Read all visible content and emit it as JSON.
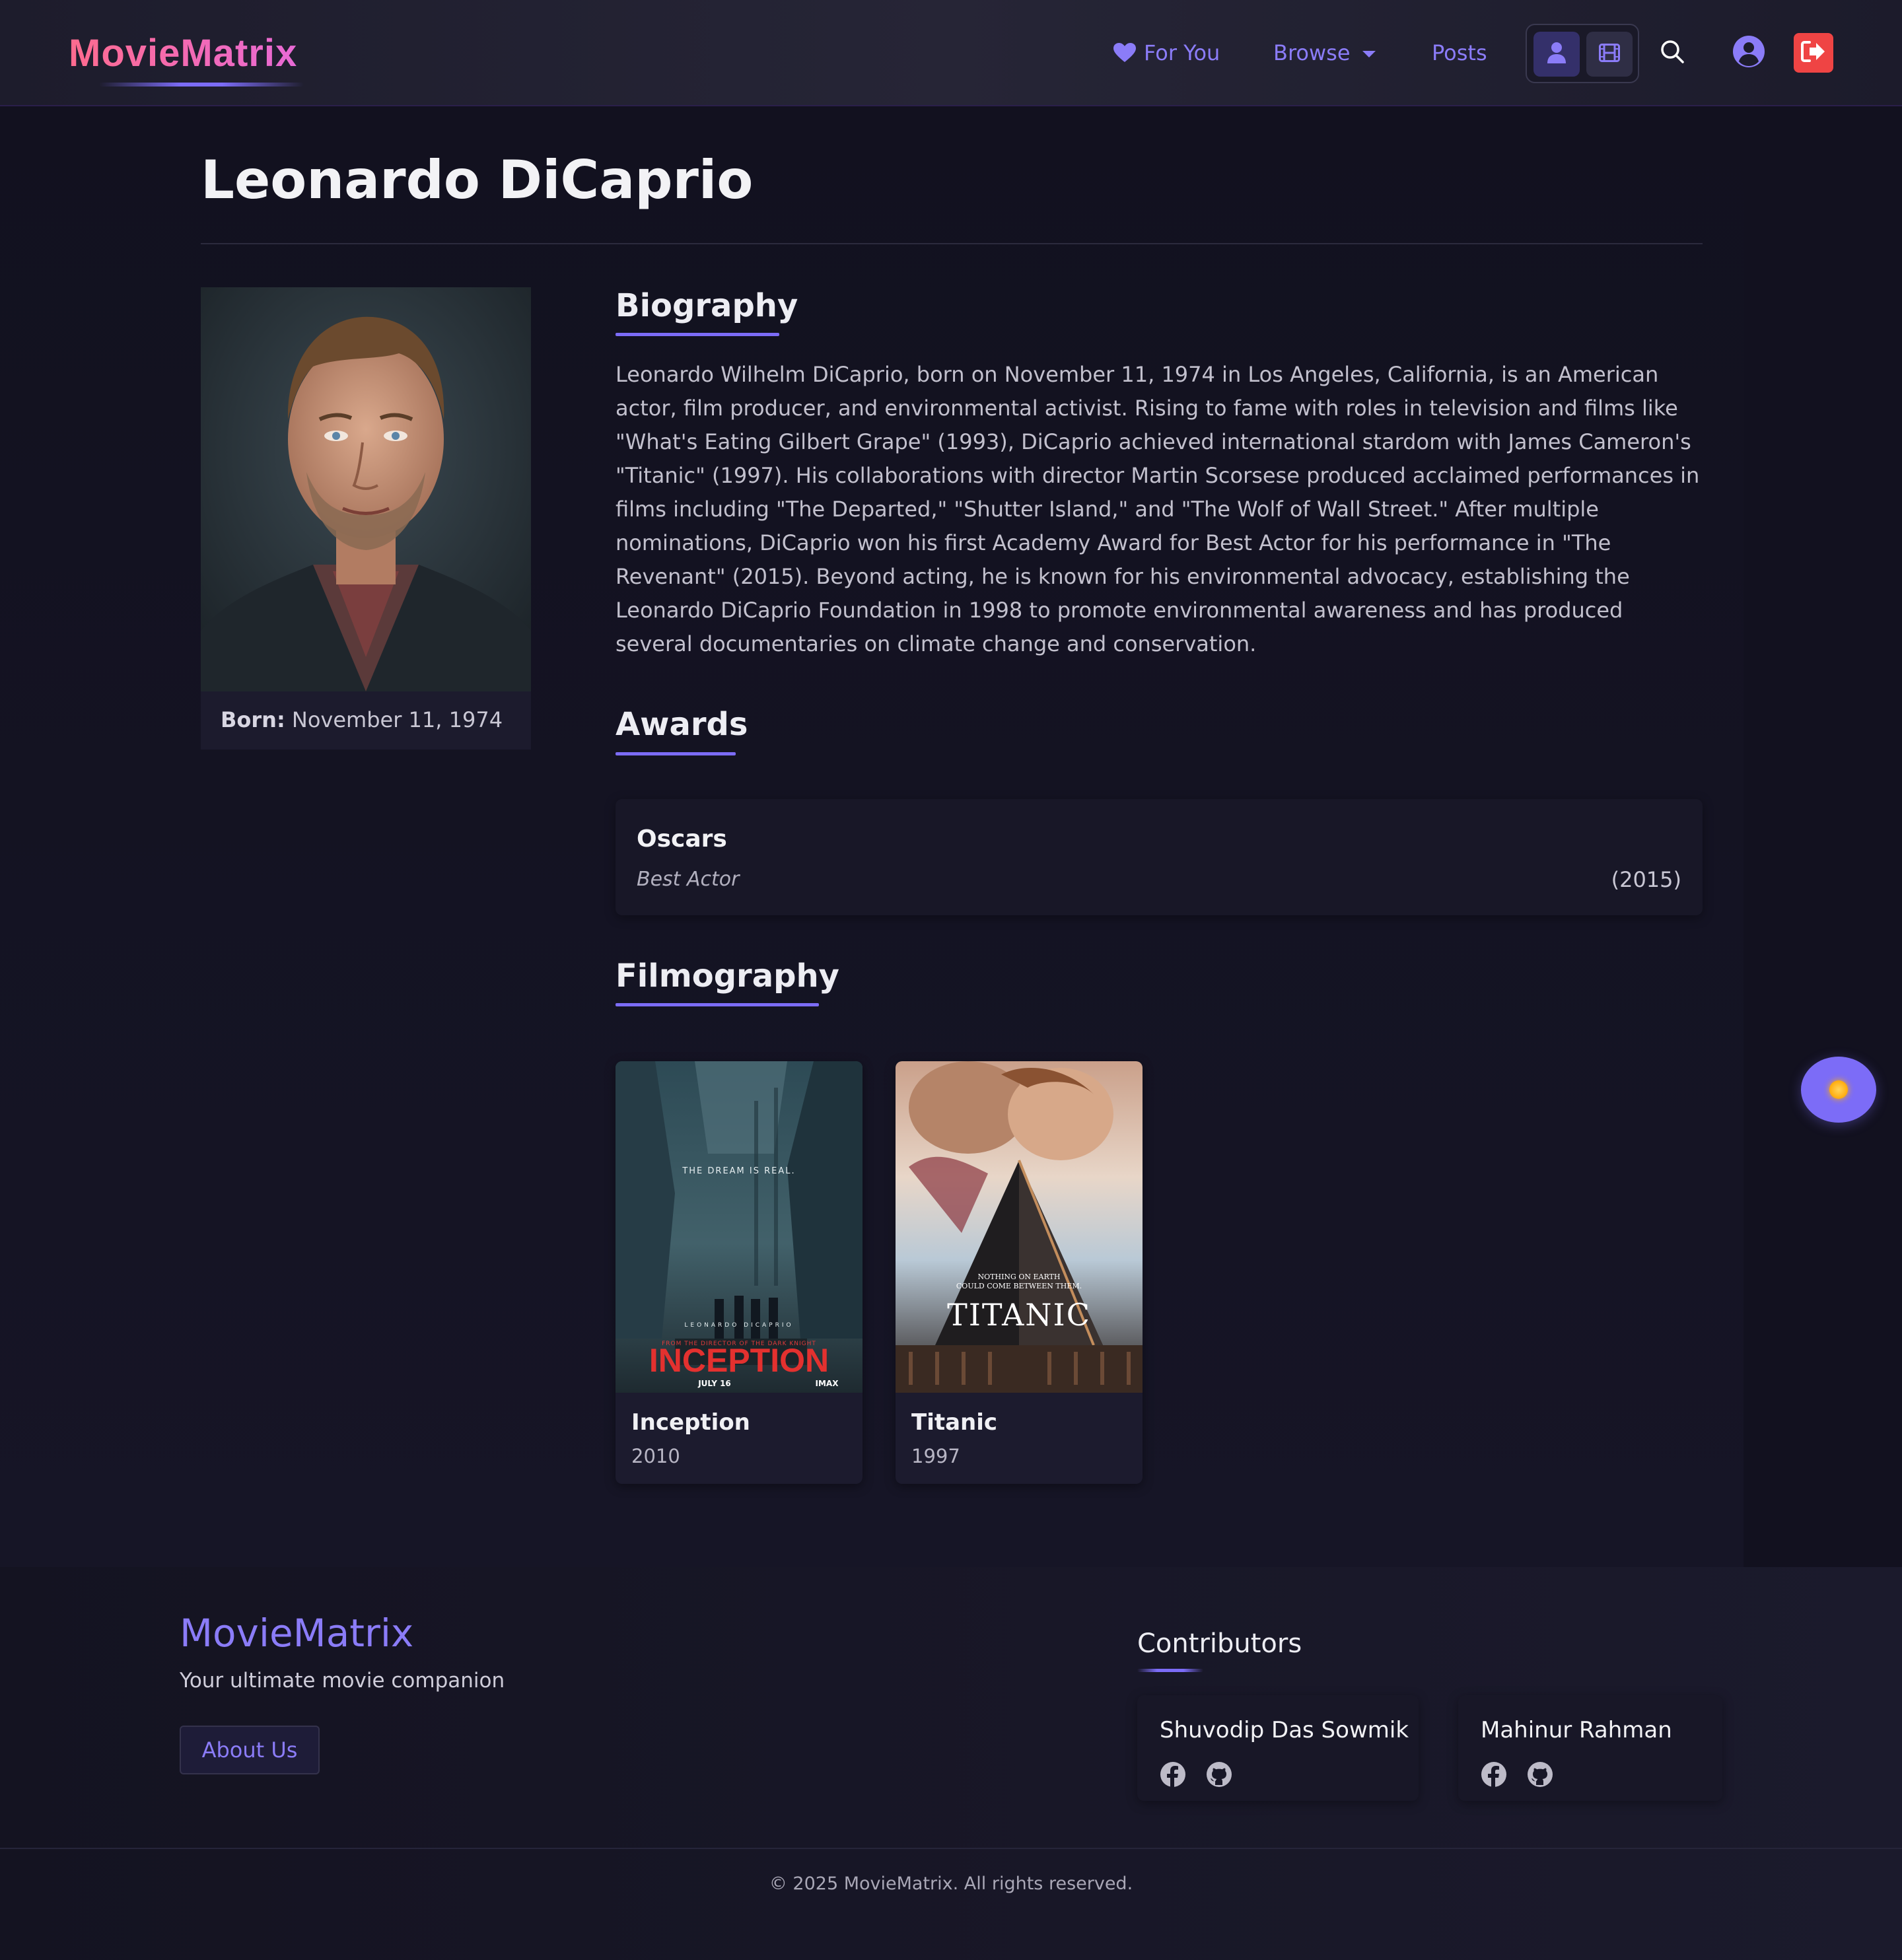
{
  "nav": {
    "brand": "MovieMatrix",
    "links": {
      "for_you": "For You",
      "browse": "Browse",
      "posts": "Posts"
    },
    "icons": [
      "heart-icon",
      "chevron-down-icon",
      "person-icon",
      "film-icon",
      "search-icon",
      "user-circle-icon",
      "logout-icon"
    ]
  },
  "person": {
    "name": "Leonardo DiCaprio",
    "born_label": "Born:",
    "born_value": "November 11, 1974"
  },
  "sections": {
    "biography": "Biography",
    "awards": "Awards",
    "filmography": "Filmography"
  },
  "biography_text": "Leonardo Wilhelm DiCaprio, born on November 11, 1974 in Los Angeles, California, is an American actor, film producer, and environmental activist. Rising to fame with roles in television and films like \"What's Eating Gilbert Grape\" (1993), DiCaprio achieved international stardom with James Cameron's \"Titanic\" (1997). His collaborations with director Martin Scorsese produced acclaimed performances in films including \"The Departed,\" \"Shutter Island,\" and \"The Wolf of Wall Street.\" After multiple nominations, DiCaprio won his first Academy Award for Best Actor for his performance in \"The Revenant\" (2015). Beyond acting, he is known for his environmental advocacy, establishing the Leonardo DiCaprio Foundation in 1998 to promote environmental awareness and has produced several documentaries on climate change and conservation.",
  "awards": [
    {
      "name": "Oscars",
      "category": "Best Actor",
      "year": "(2015)"
    }
  ],
  "films": [
    {
      "title": "Inception",
      "year": "2010",
      "poster": {
        "tagline": "THE DREAM IS REAL.",
        "actor": "LEONARDO DICAPRIO",
        "director_line": "FROM THE DIRECTOR OF THE DARK KNIGHT",
        "title": "INCEPTION",
        "release": "JULY 16",
        "format": "IMAX"
      }
    },
    {
      "title": "Titanic",
      "year": "1997",
      "poster": {
        "tagline_1": "NOTHING ON EARTH",
        "tagline_2": "COULD COME BETWEEN THEM.",
        "title": "TITANIC"
      }
    }
  ],
  "theme_toggle": "sun-icon",
  "footer": {
    "brand": "MovieMatrix",
    "tagline": "Your ultimate movie companion",
    "about": "About Us",
    "contributors_title": "Contributors",
    "contributors": [
      {
        "name": "Shuvodip Das Sowmik"
      },
      {
        "name": "Mahinur Rahman"
      }
    ],
    "copyright": "© 2025 MovieMatrix. All rights reserved."
  },
  "colors": {
    "accent": "#7c6cf7",
    "nav_link": "#8b7cf8",
    "logout": "#ef4444",
    "brand_gradient_start": "#ff6b8e",
    "brand_gradient_end": "#e86ad6",
    "background": "#12111f"
  }
}
